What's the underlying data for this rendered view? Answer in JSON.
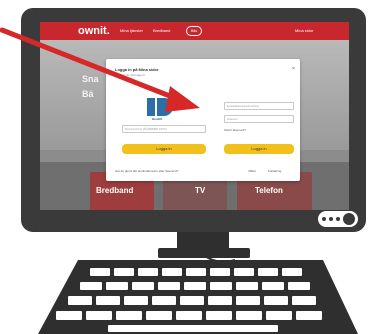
{
  "header": {
    "logo": "ownit.",
    "nav": [
      "Mina tjänster",
      "Bredband",
      "Bäs"
    ],
    "right": [
      "",
      "Mina sidor"
    ]
  },
  "hero": {
    "line1": "Sna",
    "line2": "Bä"
  },
  "modal": {
    "title": "Logga in på Mina sidor",
    "subtitle": "Välj hur du vill logga in",
    "close": "×",
    "bankid_label": "BankID",
    "personnummer_placeholder": "Personnummer (ÅÅÅÅMMDD-XXXX)",
    "email_placeholder": "E-postadress/personnummer",
    "password_placeholder": "Lösenord",
    "forgot": "Glömt lösenord?",
    "login_left": "Logga in",
    "login_right": "Logga in",
    "footer_question": "Har du glömt ditt användarnamn eller lösenord?",
    "footer_link_a": "Villkor",
    "footer_link_b": "Förklaring"
  },
  "cards": [
    {
      "label": "Bredband"
    },
    {
      "label": "TV"
    },
    {
      "label": "Telefon"
    }
  ],
  "colors": {
    "brand": "#c8282d",
    "button": "#f2c01a",
    "arrow": "#d62828"
  },
  "icons": {
    "arrow": "arrow-icon",
    "more": "more-dots-icon",
    "bankid": "bankid-icon"
  }
}
